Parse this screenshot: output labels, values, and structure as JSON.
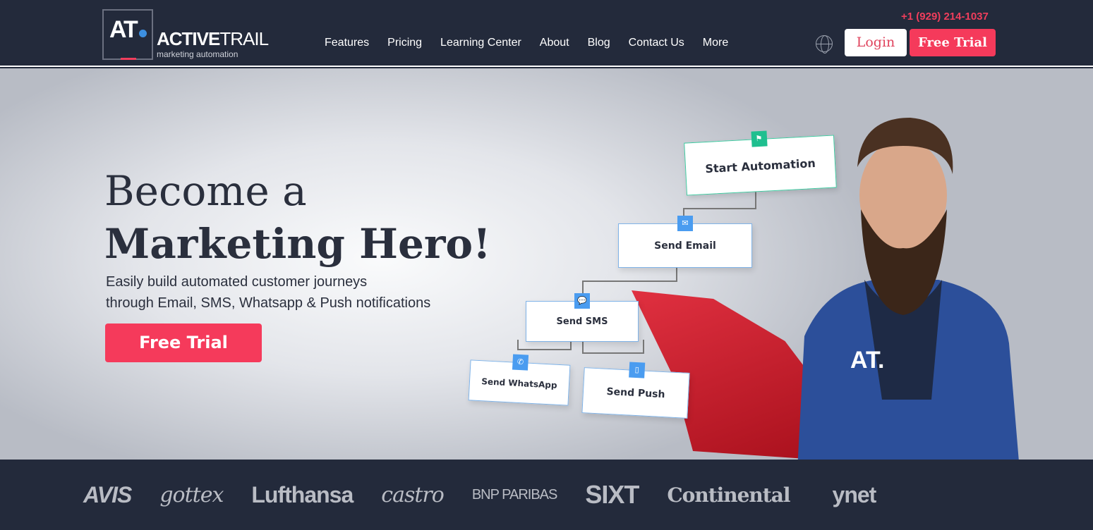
{
  "nav": {
    "logo_mark": "AT",
    "brand_bold": "ACTIVE",
    "brand_light": "TRAIL",
    "tagline": "marketing automation",
    "items": [
      "Features",
      "Pricing",
      "Learning Center",
      "About",
      "Blog",
      "Contact Us",
      "More"
    ],
    "phone": "+1 (929) 214-1037",
    "login": "Login",
    "free_trial": "Free Trial"
  },
  "hero": {
    "title_line1": "Become a",
    "title_line2": "Marketing Hero!",
    "sub_line1": "Easily build automated customer journeys",
    "sub_line2": "through Email, SMS, Whatsapp & Push notifications",
    "cta": "Free Trial",
    "flow": {
      "start": "Start Automation",
      "email": "Send Email",
      "sms": "Send SMS",
      "whatsapp": "Send WhatsApp",
      "push": "Send Push"
    },
    "shirt_logo": "AT."
  },
  "logos": [
    "AVIS",
    "gottex",
    "Lufthansa",
    "castro",
    "BNP PARIBAS",
    "SIXT",
    "Continental",
    "ynet"
  ],
  "colors": {
    "accent": "#f53a5b",
    "nav_bg": "#232a3b",
    "node_icon": "#4a9cf0",
    "start_icon": "#1fbf8f"
  }
}
